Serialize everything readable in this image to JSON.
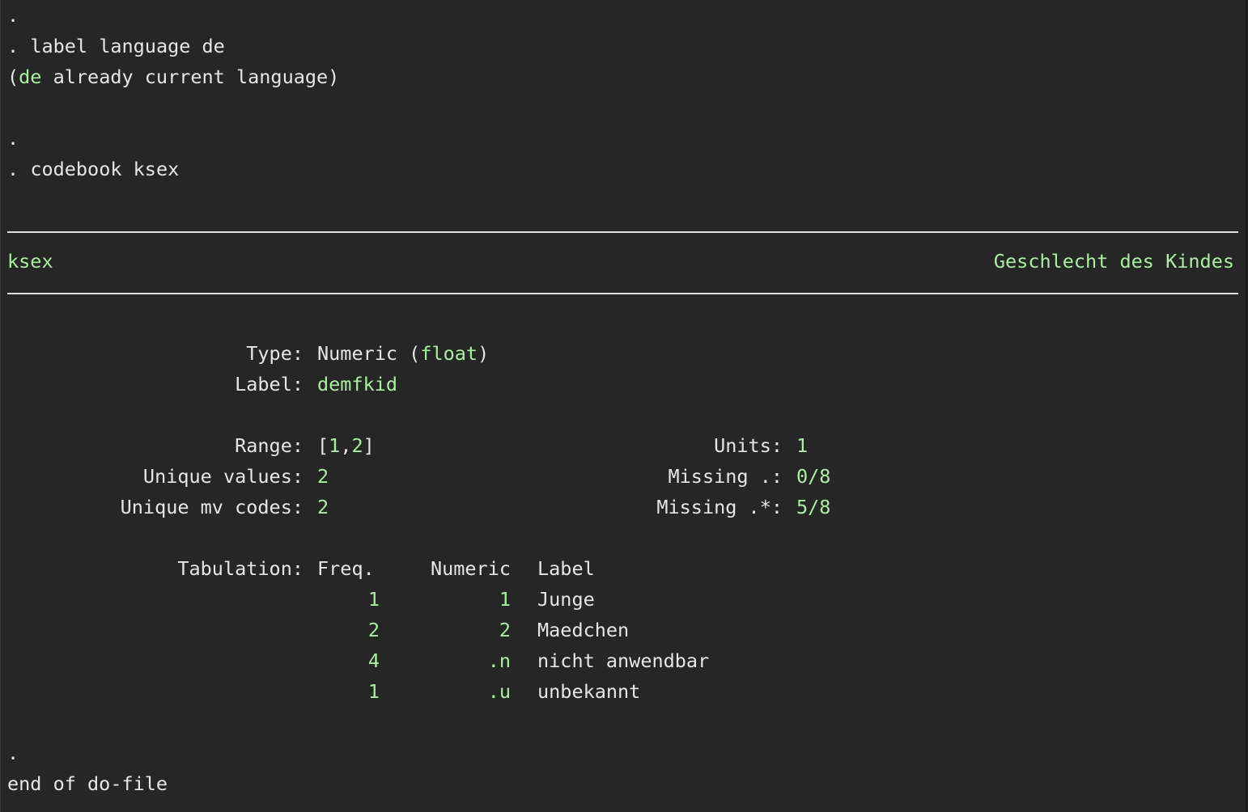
{
  "console": {
    "lines": [
      {
        "prompt": ".",
        "text": ""
      },
      {
        "prompt": ".",
        "text": "label language de"
      },
      {
        "paren_open": "(",
        "lang": "de",
        "rest": " already current language)"
      },
      {
        "prompt": ".",
        "text": ""
      },
      {
        "prompt": ".",
        "text": "codebook ksex"
      }
    ],
    "var_header": {
      "name": "ksex",
      "label": "Geschlecht des Kindes"
    },
    "details": {
      "type_label": "Type:",
      "type_value_prefix": "Numeric (",
      "type_value_storage": "float",
      "type_value_suffix": ")",
      "label_label": "Label:",
      "label_value": "demfkid",
      "range_label": "Range:",
      "range_open": "[",
      "range_lo": "1",
      "range_comma": ",",
      "range_hi": "2",
      "range_close": "]",
      "units_label": "Units:",
      "units_value": "1",
      "unique_values_label": "Unique values:",
      "unique_values_value": "2",
      "missing_dot_label": "Missing .:",
      "missing_dot_value": "0/8",
      "unique_mv_label": "Unique mv codes:",
      "unique_mv_value": "2",
      "missing_star_label": "Missing .*:",
      "missing_star_value": "5/8"
    },
    "tabulation": {
      "label": "Tabulation:",
      "headers": [
        "Freq.",
        "Numeric",
        "Label"
      ],
      "rows": [
        {
          "freq": "1",
          "numeric": "1",
          "label": "Junge"
        },
        {
          "freq": "2",
          "numeric": "2",
          "label": "Maedchen"
        },
        {
          "freq": "4",
          "numeric": ".n",
          "label": "nicht anwendbar"
        },
        {
          "freq": "1",
          "numeric": ".u",
          "label": "unbekannt"
        }
      ]
    },
    "footer": {
      "prompt": ".",
      "end_text": "end of do-file"
    }
  },
  "colors": {
    "background": "#262626",
    "text": "#e6e6e6",
    "result_green": "#a8f0a0"
  }
}
